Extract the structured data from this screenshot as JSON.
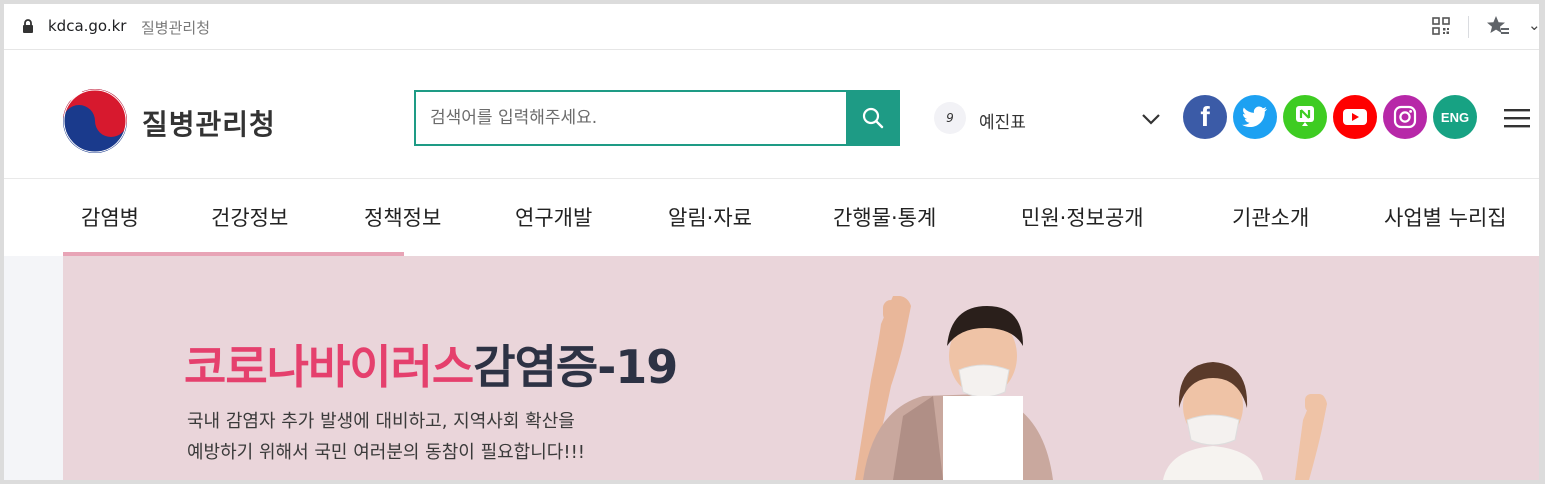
{
  "browser": {
    "url_host": "kdca.go.kr",
    "tab_title": "질병관리청",
    "more_glyph": "⌄"
  },
  "header": {
    "logo_text": "질병관리청",
    "search_placeholder": "검색어를 입력해주세요.",
    "rank_number": "9",
    "rank_keyword": "예진표",
    "social": {
      "facebook": "f",
      "english": "ENG"
    }
  },
  "nav": {
    "items": [
      "감염병",
      "건강정보",
      "정책정보",
      "연구개발",
      "알림·자료",
      "간행물·통계",
      "민원·정보공개",
      "기관소개",
      "사업별 누리집"
    ]
  },
  "banner": {
    "title_pink": "코로나바이러스",
    "title_dark": "감염증-19",
    "desc_line1": "국내 감염자 추가 발생에 대비하고, 지역사회 확산을",
    "desc_line2": "예방하기 위해서 국민 여러분의 동참이 필요합니다!!!"
  },
  "colors": {
    "accent": "#1e9b85",
    "banner_pink": "#e5406d",
    "banner_bg": "#ead5da"
  }
}
